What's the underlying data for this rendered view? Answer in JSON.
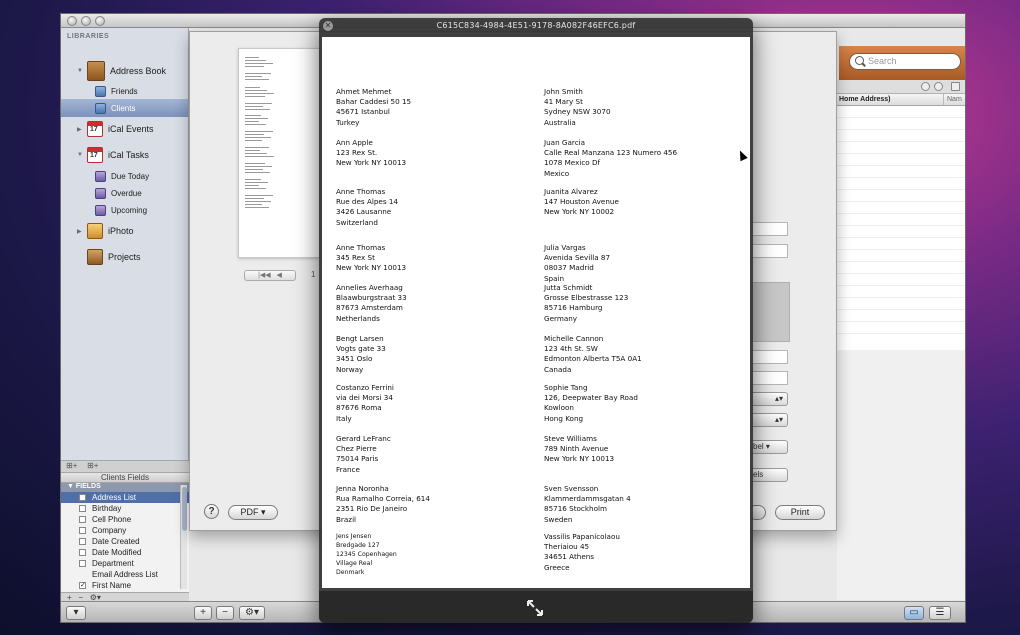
{
  "sidebar": {
    "section_header": "LIBRARIES",
    "items": [
      {
        "label": "Address Book",
        "level": 0,
        "icon": "address-book-icon"
      },
      {
        "label": "Friends",
        "level": 1,
        "icon": "group-icon"
      },
      {
        "label": "Clients",
        "level": 1,
        "icon": "group-icon",
        "selected": true
      },
      {
        "label": "iCal Events",
        "level": 0,
        "icon": "calendar-icon"
      },
      {
        "label": "iCal Tasks",
        "level": 0,
        "icon": "calendar-icon"
      },
      {
        "label": "Due Today",
        "level": 1,
        "icon": "smart-list-icon"
      },
      {
        "label": "Overdue",
        "level": 1,
        "icon": "smart-list-icon"
      },
      {
        "label": "Upcoming",
        "level": 1,
        "icon": "smart-list-icon"
      },
      {
        "label": "iPhoto",
        "level": 0,
        "icon": "iphoto-icon"
      },
      {
        "label": "Projects",
        "level": 0,
        "icon": "projects-icon"
      }
    ]
  },
  "fields_panel": {
    "title": "Clients Fields",
    "group": "FIELDS",
    "items": [
      {
        "label": "Address List",
        "checked": false,
        "highlighted": true
      },
      {
        "label": "Birthday",
        "checked": false
      },
      {
        "label": "Cell Phone",
        "checked": false
      },
      {
        "label": "Company",
        "checked": false
      },
      {
        "label": "Date Created",
        "checked": false
      },
      {
        "label": "Date Modified",
        "checked": false
      },
      {
        "label": "Department",
        "checked": false
      },
      {
        "label": "Email Address List",
        "checked": false
      },
      {
        "label": "First Name",
        "checked": true
      }
    ]
  },
  "search": {
    "placeholder": "Search"
  },
  "list_header": {
    "col1": "Home Address)",
    "col2": "Nam"
  },
  "print_dialog": {
    "page_number": "1",
    "pdf_button": "PDF ▾",
    "print_button": "Print",
    "help_button": "?",
    "popup_labels": [
      "bel",
      "els"
    ]
  },
  "quicklook": {
    "title": "C615C834-4984-4E51-9178-8A082F46EFC6.pdf",
    "left_column": [
      [
        "Ahmet Mehmet",
        "Bahar Caddesi 50 15",
        "45671 Istanbul",
        "Turkey"
      ],
      [
        "Ann Apple",
        "123 Rex St.",
        "New York NY 10013"
      ],
      [
        "Anne Thomas",
        "Rue des Alpes 14",
        "3426 Lausanne",
        "Switzerland"
      ],
      [
        "Anne Thomas",
        "345 Rex St",
        "New York NY 10013"
      ],
      [
        "Annelies Averhaag",
        "Blaawburgstraat 33",
        "87673 Amsterdam",
        "Netherlands"
      ],
      [
        "Bengt Larsen",
        "Vogts gate 33",
        "3451 Oslo",
        "Norway"
      ],
      [
        "Costanzo Ferrini",
        "via dei Morsi 34",
        "87676 Roma",
        "Italy"
      ],
      [
        "Gerard LeFranc",
        "Chez Pierre",
        "75014 Paris",
        "France"
      ],
      [
        "Jenna Noronha",
        "Rua Ramalho Correia, 614",
        "2351 Rio De Janeiro",
        "Brazil"
      ],
      [
        "Jens Jensen",
        "Bredgade 127",
        "12345 Copenhagen",
        "Village Real",
        "Denmark"
      ]
    ],
    "right_column": [
      [
        "John Smith",
        "41 Mary St",
        "Sydney NSW 3070",
        "Australia"
      ],
      [
        "Juan Garcia",
        "Calle Real Manzana 123 Numero 456",
        "1078 Mexico Df",
        "Mexico"
      ],
      [
        "Juanita Alvarez",
        "147 Houston Avenue",
        "New York NY 10002"
      ],
      [
        "Julia Vargas",
        "Avenida Sevilla 87",
        "08037 Madrid",
        "Spain"
      ],
      [
        "Jutta Schmidt",
        "Grosse Elbestrasse 123",
        "85716 Hamburg",
        "Germany"
      ],
      [
        "Michelle Cannon",
        "123 4th St. SW",
        "Edmonton Alberta T5A 0A1",
        "Canada"
      ],
      [
        "Sophie Tang",
        "126, Deepwater Bay Road",
        "Kowloon",
        "Hong Kong"
      ],
      [
        "Steve Williams",
        "789 Ninth Avenue",
        "New York NY 10013"
      ],
      [
        "Sven Svensson",
        "Klammerdammsgatan 4",
        "85716 Stockholm",
        "Sweden"
      ],
      [
        "Vassilis Papanicolaou",
        "Theriaiou 45",
        "34651 Athens",
        "Greece"
      ]
    ]
  },
  "colors": {
    "sidebar_selection": "#7c92bb",
    "toolbar_accent": "#c0703a",
    "quicklook_bg": "#323232"
  }
}
